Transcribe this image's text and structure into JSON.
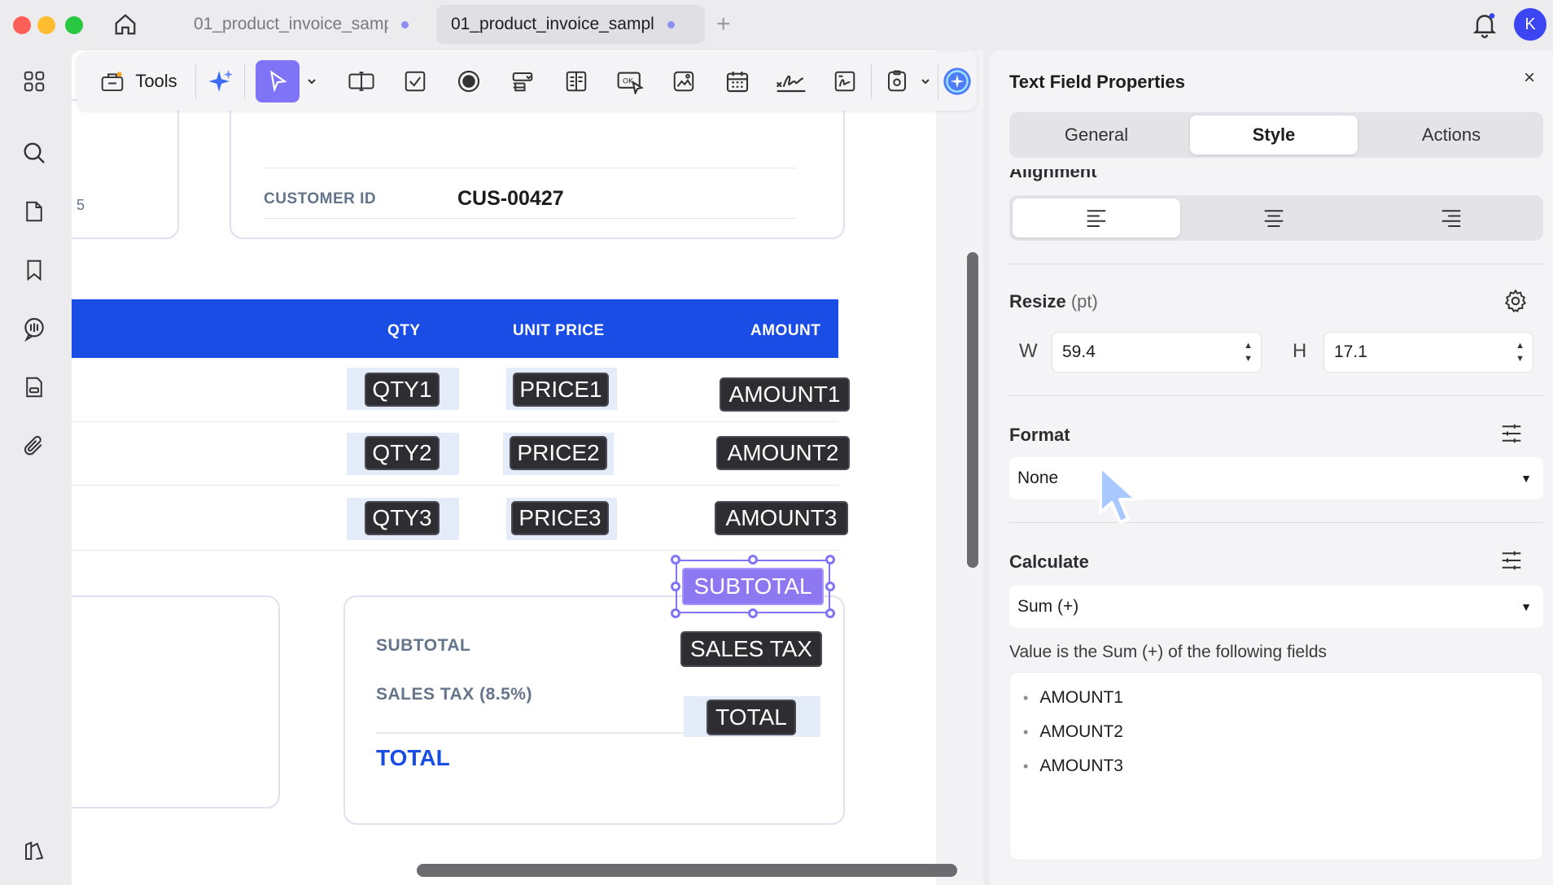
{
  "tabs": [
    {
      "label": "01_product_invoice_sample.pdf",
      "active": false
    },
    {
      "label": "01_product_invoice_sample.pdf",
      "active": true
    }
  ],
  "avatar_initial": "K",
  "toolbar": {
    "tools_label": "Tools"
  },
  "document": {
    "customer_id_label": "CUSTOMER ID",
    "customer_id_value": "CUS-00427",
    "partial_left_char": "5",
    "table_headers": {
      "qty": "QTY",
      "unit_price": "UNIT PRICE",
      "amount": "AMOUNT"
    },
    "rows": [
      {
        "qty": "QTY1",
        "price": "PRICE1",
        "amount": "AMOUNT1"
      },
      {
        "qty": "QTY2",
        "price": "PRICE2",
        "amount": "AMOUNT2"
      },
      {
        "qty": "QTY3",
        "price": "PRICE3",
        "amount": "AMOUNT3"
      }
    ],
    "summary": {
      "subtotal_label": "SUBTOTAL",
      "subtotal_field": "SUBTOTAL",
      "sales_tax_label": "SALES TAX (8.5%)",
      "sales_tax_field": "SALES TAX",
      "total_label": "TOTAL",
      "total_field": "TOTAL"
    }
  },
  "panel": {
    "title": "Text Field Properties",
    "close": "×",
    "tabs": [
      "General",
      "Style",
      "Actions"
    ],
    "active_tab": "Style",
    "alignment_label": "Alignment",
    "resize_label": "Resize",
    "resize_unit": "(pt)",
    "width_label": "W",
    "width_value": "59.4",
    "height_label": "H",
    "height_value": "17.1",
    "format_label": "Format",
    "format_value": "None",
    "calculate_label": "Calculate",
    "calculate_value": "Sum (+)",
    "calc_description": "Value is the Sum (+) of the following fields",
    "calc_fields": [
      "AMOUNT1",
      "AMOUNT2",
      "AMOUNT3"
    ]
  },
  "colors": {
    "accent": "#7f74f6",
    "table_header": "#1a4de6",
    "total_blue": "#1a4de6",
    "avatar": "#3b45f2"
  }
}
